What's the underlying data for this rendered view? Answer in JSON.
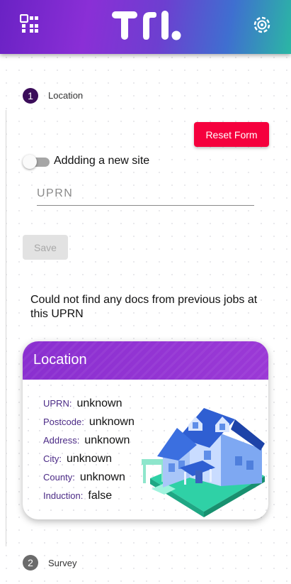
{
  "header": {
    "menu_icon": "grid-menu-icon",
    "logo_icon": "tl-logo",
    "settings_icon": "settings-gear-icon",
    "colors": {
      "start": "#6a22c4",
      "end": "#2bb7a4"
    }
  },
  "steps": [
    {
      "number": "1",
      "label": "Location",
      "color": "#3b0d5a"
    },
    {
      "number": "2",
      "label": "Survey",
      "color": "#6b6b6b"
    }
  ],
  "form": {
    "reset_label": "Reset Form",
    "toggle_label": "Addding a new site",
    "toggle_on": false,
    "uprn_placeholder": "UPRN",
    "uprn_value": "",
    "save_label": "Save",
    "save_disabled": true,
    "reset_color": "#f5003d"
  },
  "message": "Could not find any docs from previous jobs at this UPRN",
  "location_card": {
    "title": "Location",
    "image": "house-illustration",
    "fields": [
      {
        "key": "UPRN:",
        "value": "unknown"
      },
      {
        "key": "Postcode:",
        "value": "unknown"
      },
      {
        "key": "Address:",
        "value": "unknown"
      },
      {
        "key": "City:",
        "value": "unknown"
      },
      {
        "key": "County:",
        "value": "unknown"
      },
      {
        "key": "Induction:",
        "value": "false"
      }
    ],
    "header_color": "#8a2fd0"
  }
}
